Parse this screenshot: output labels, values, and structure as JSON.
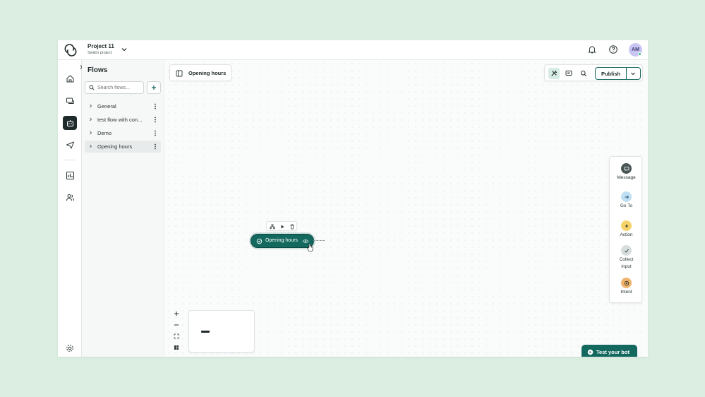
{
  "header": {
    "project_name": "Project 11",
    "project_switch": "Switch project",
    "avatar_initials": "AM"
  },
  "sidebar": {
    "title": "Flows",
    "search_placeholder": "Search flows...",
    "flows": [
      {
        "label": "General"
      },
      {
        "label": "test flow with con..."
      },
      {
        "label": "Demo"
      },
      {
        "label": "Opening hours",
        "selected": true
      }
    ]
  },
  "canvas": {
    "breadcrumb": "Opening hours",
    "publish_label": "Publish",
    "node_label": "Opening hours",
    "test_bot_label": "Test your bot"
  },
  "palette": {
    "items": [
      {
        "label": "Message",
        "icon": "message-icon",
        "color": "#4a5656"
      },
      {
        "label": "Go To",
        "icon": "arrow-right-icon",
        "color": "#bfe0f2"
      },
      {
        "label": "Action",
        "icon": "lightning-icon",
        "color": "#f5d36a"
      },
      {
        "label": "Collect\nInput",
        "icon": "check-input-icon",
        "color": "#d7dcdc"
      },
      {
        "label": "Intent",
        "icon": "target-icon",
        "color": "#f0b46c"
      }
    ]
  },
  "colors": {
    "accent": "#14695f",
    "background": "#dbeee1"
  }
}
